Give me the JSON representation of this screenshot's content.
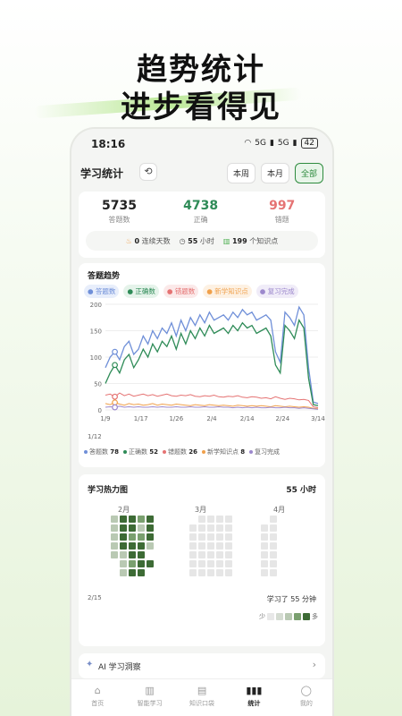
{
  "headline": {
    "line1": "趋势统计",
    "line2": "进步看得见"
  },
  "status": {
    "time": "18:16",
    "signal1": "5G",
    "signal2": "5G",
    "battery": "42"
  },
  "topbar": {
    "title": "学习统计",
    "tabs": [
      "本周",
      "本月",
      "全部"
    ],
    "active_tab": "全部"
  },
  "summary": {
    "answered": {
      "value": "5735",
      "label": "答题数"
    },
    "correct": {
      "value": "4738",
      "label": "正确"
    },
    "wrong": {
      "value": "997",
      "label": "错题"
    },
    "streak": {
      "value": "0",
      "label": "连续天数"
    },
    "hours": {
      "value": "55",
      "label": "小时"
    },
    "points": {
      "value": "199",
      "label": "个知识点"
    }
  },
  "colors": {
    "answered": "#6f8fd8",
    "correct": "#2e8b57",
    "wrong": "#e57373",
    "new": "#f0a04b",
    "review": "#9c88cc",
    "heat_dark": "#3d6b35",
    "heat_mid": "#7aa06f",
    "heat_light": "#b9c9b3",
    "heat_empty": "#e8e8e8"
  },
  "chart_data": {
    "type": "line",
    "title": "答题趋势",
    "x_ticks": [
      "1/9",
      "1/17",
      "1/26",
      "2/4",
      "2/14",
      "2/24",
      "3/14"
    ],
    "y_ticks": [
      "0",
      "50",
      "100",
      "150",
      "200"
    ],
    "ylim": [
      0,
      200
    ],
    "selected_date": "1/12",
    "series": [
      {
        "name": "答题数",
        "summary": "78",
        "values": [
          80,
          100,
          110,
          95,
          120,
          130,
          105,
          115,
          140,
          125,
          150,
          135,
          155,
          145,
          165,
          140,
          170,
          150,
          175,
          160,
          180,
          165,
          185,
          170,
          175,
          180,
          170,
          185,
          175,
          190,
          180,
          185,
          170,
          175,
          180,
          170,
          110,
          90,
          185,
          175,
          160,
          195,
          180,
          80,
          15,
          12
        ]
      },
      {
        "name": "正确数",
        "summary": "52",
        "values": [
          50,
          70,
          85,
          70,
          95,
          105,
          80,
          95,
          115,
          100,
          125,
          110,
          130,
          120,
          140,
          115,
          145,
          125,
          150,
          135,
          155,
          140,
          160,
          145,
          150,
          155,
          145,
          160,
          150,
          165,
          155,
          160,
          145,
          150,
          155,
          140,
          85,
          70,
          160,
          150,
          135,
          170,
          155,
          60,
          10,
          8
        ]
      },
      {
        "name": "错题数",
        "summary": "26",
        "values": [
          28,
          30,
          25,
          32,
          27,
          30,
          26,
          28,
          30,
          27,
          29,
          26,
          28,
          30,
          27,
          26,
          28,
          27,
          29,
          26,
          25,
          27,
          26,
          28,
          25,
          24,
          26,
          25,
          27,
          24,
          23,
          25,
          24,
          22,
          23,
          21,
          25,
          22,
          20,
          22,
          21,
          19,
          20,
          18,
          6,
          4
        ]
      },
      {
        "name": "新学知识点",
        "summary": "8",
        "values": [
          12,
          10,
          14,
          11,
          9,
          12,
          10,
          11,
          9,
          10,
          12,
          9,
          11,
          10,
          9,
          11,
          10,
          9,
          8,
          10,
          9,
          8,
          10,
          9,
          8,
          9,
          8,
          7,
          9,
          8,
          7,
          8,
          7,
          8,
          7,
          6,
          8,
          7,
          6,
          7,
          6,
          5,
          6,
          5,
          3,
          2
        ]
      },
      {
        "name": "复习完成",
        "summary": "5",
        "values": [
          5,
          6,
          5,
          7,
          5,
          6,
          5,
          6,
          5,
          5,
          6,
          5,
          6,
          5,
          5,
          6,
          5,
          5,
          6,
          5,
          5,
          6,
          5,
          5,
          6,
          5,
          5,
          4,
          5,
          4,
          5,
          4,
          5,
          4,
          4,
          5,
          4,
          4,
          5,
          4,
          4,
          3,
          4,
          3,
          2,
          1
        ]
      }
    ]
  },
  "heatmap": {
    "title": "学习热力图",
    "total": "55 小时",
    "months": [
      "2月",
      "3月",
      "4月"
    ],
    "date": "2/15",
    "summary": "学习了 55 分钟",
    "scale_low": "少",
    "scale_high": "多"
  },
  "ai": {
    "label": "AI 学习洞察"
  },
  "nav": [
    {
      "label": "首页",
      "icon": "home-icon"
    },
    {
      "label": "智能学习",
      "icon": "book-icon"
    },
    {
      "label": "知识口袋",
      "icon": "pocket-icon"
    },
    {
      "label": "统计",
      "icon": "bar-chart-icon"
    },
    {
      "label": "我的",
      "icon": "user-icon"
    }
  ]
}
